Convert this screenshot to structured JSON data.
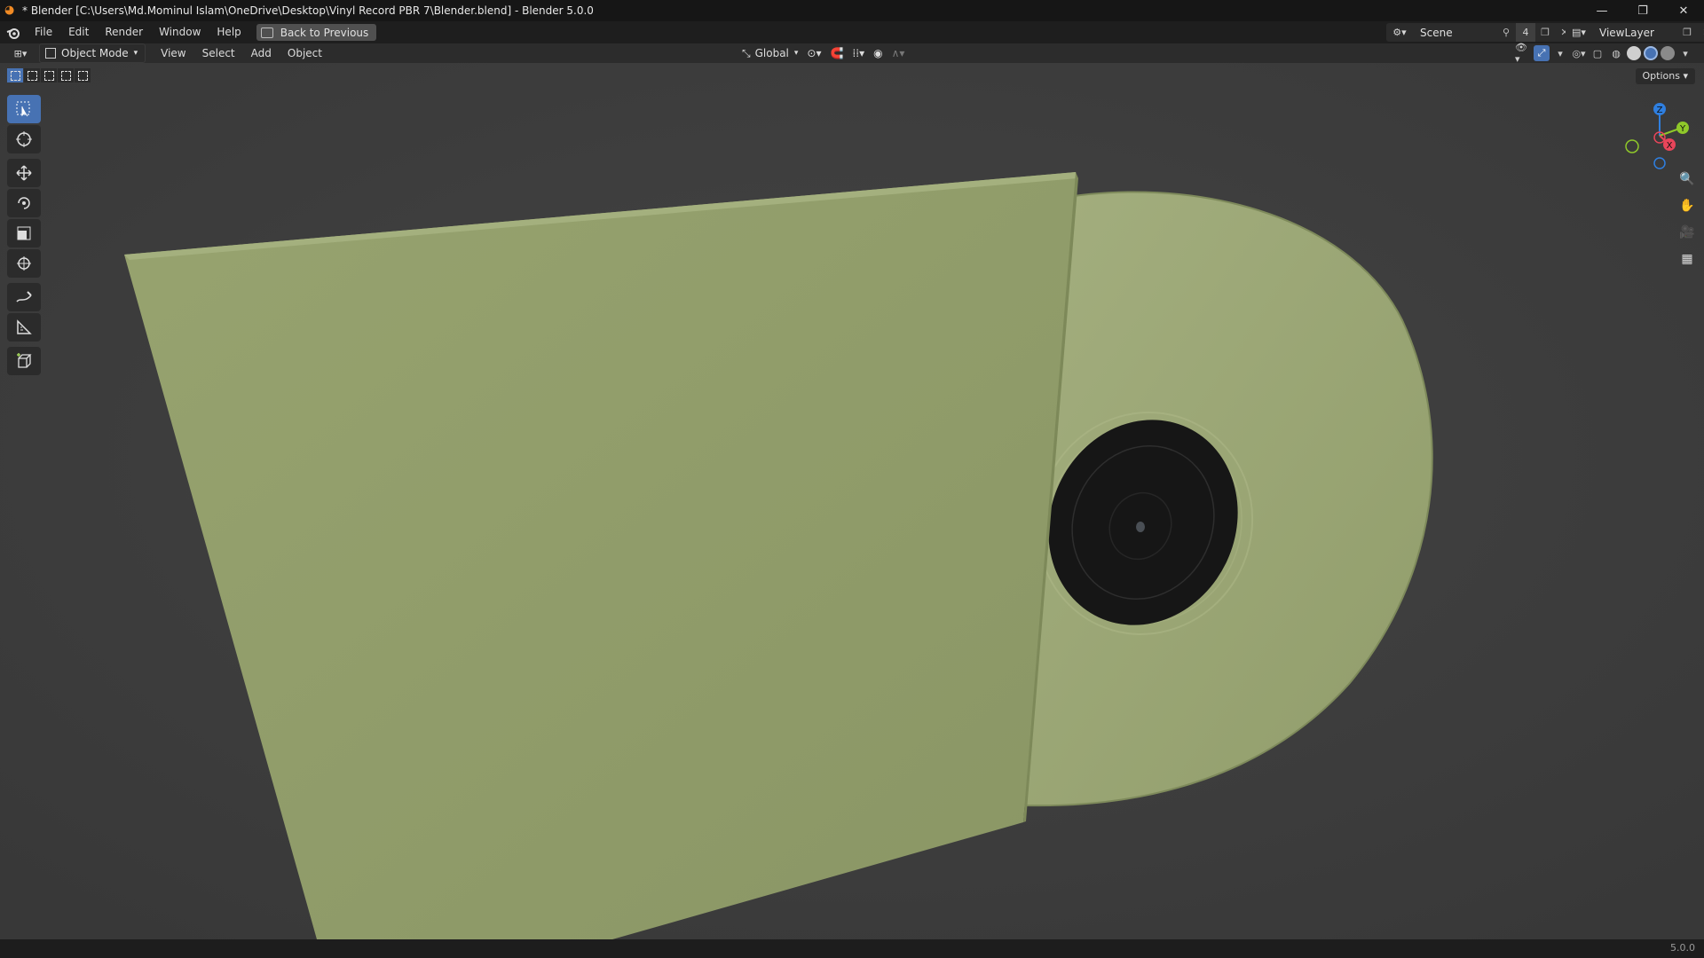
{
  "window": {
    "title": "* Blender [C:\\Users\\Md.Mominul Islam\\OneDrive\\Desktop\\Vinyl Record PBR 7\\Blender.blend] - Blender 5.0.0",
    "minimize_icon": "minimize-icon",
    "maximize_icon": "maximize-icon",
    "close_icon": "close-icon"
  },
  "menubar": {
    "items": [
      "File",
      "Edit",
      "Render",
      "Window",
      "Help"
    ],
    "back_button": "Back to Previous",
    "scene_name": "Scene",
    "scene_users": "4",
    "view_layer": "ViewLayer"
  },
  "header": {
    "mode": "Object Mode",
    "menus": [
      "View",
      "Select",
      "Add",
      "Object"
    ],
    "orientation": "Global"
  },
  "viewport": {
    "options_label": "Options",
    "gizmo": {
      "x": "X",
      "y": "Y",
      "z": "Z"
    },
    "colors": {
      "background": "#3d3d3d",
      "sleeve": "#8f9b6a",
      "record": "#a2ad7c",
      "label": "#161616",
      "axis_x": "#e8455a",
      "axis_y": "#8fc82a",
      "axis_z": "#2f7fe0",
      "active_blue": "#4772b3"
    }
  },
  "tools": [
    "select-box-icon",
    "cursor-icon",
    "move-icon",
    "rotate-icon",
    "scale-icon",
    "transform-icon",
    "annotate-icon",
    "measure-icon",
    "add-cube-icon"
  ],
  "status": {
    "version": "5.0.0"
  }
}
